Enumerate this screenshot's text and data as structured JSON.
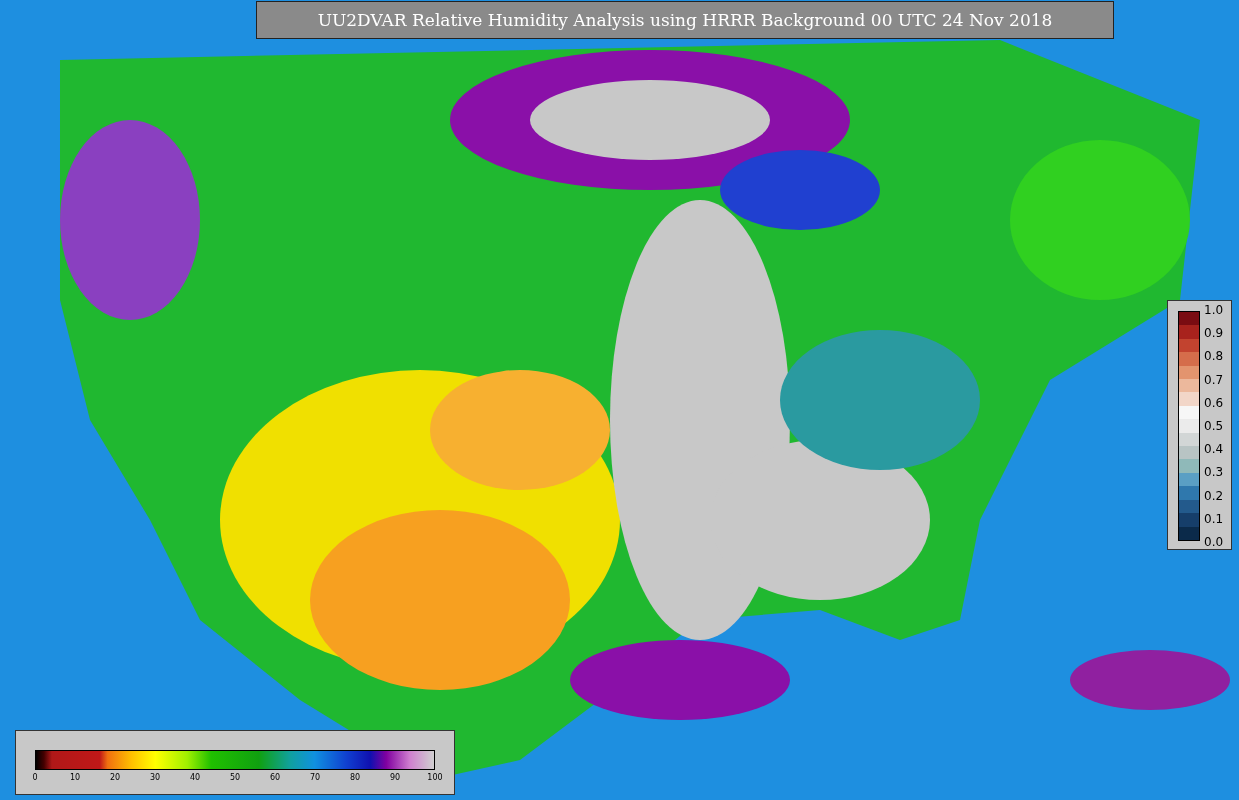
{
  "title": "UU2DVAR Relative Humidity Analysis using HRRR Background 00 UTC 24 Nov 2018",
  "ratio_colorbar": {
    "ticks": [
      "1.0",
      "0.9",
      "0.8",
      "0.7",
      "0.6",
      "0.5",
      "0.4",
      "0.3",
      "0.2",
      "0.1",
      "0.0"
    ]
  },
  "humidity_colorbar": {
    "ticks": [
      "0",
      "10",
      "20",
      "30",
      "40",
      "50",
      "60",
      "70",
      "80",
      "90",
      "100"
    ]
  }
}
